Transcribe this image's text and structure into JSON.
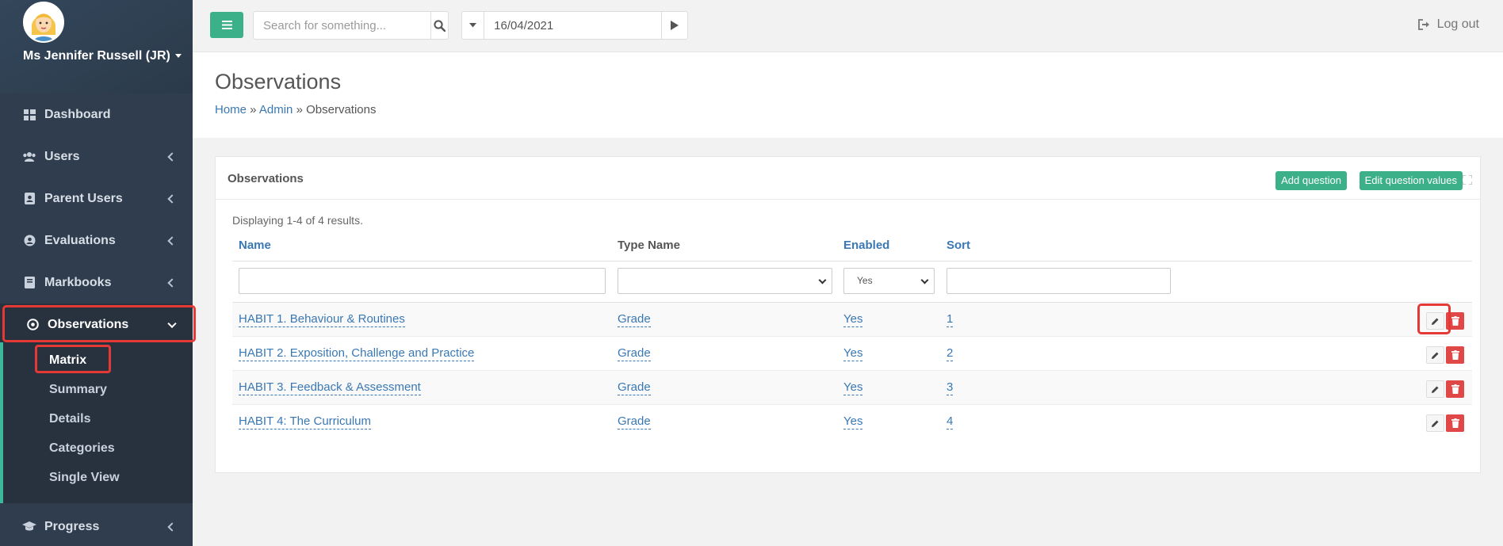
{
  "user": {
    "name": "Ms Jennifer Russell (JR)"
  },
  "sidebar": {
    "items": [
      {
        "label": "Dashboard",
        "icon": "dashboard-icon"
      },
      {
        "label": "Users",
        "icon": "users-icon"
      },
      {
        "label": "Parent Users",
        "icon": "parent-users-icon"
      },
      {
        "label": "Evaluations",
        "icon": "evaluations-icon"
      },
      {
        "label": "Markbooks",
        "icon": "markbooks-icon"
      },
      {
        "label": "Observations",
        "icon": "observations-icon",
        "active": true
      }
    ],
    "submenu": [
      {
        "label": "Matrix",
        "current": true
      },
      {
        "label": "Summary"
      },
      {
        "label": "Details"
      },
      {
        "label": "Categories"
      },
      {
        "label": "Single View"
      }
    ],
    "bottom_item": {
      "label": "Progress",
      "icon": "graduation-cap-icon"
    }
  },
  "topbar": {
    "search_placeholder": "Search for something...",
    "date_value": "16/04/2021",
    "logout_label": "Log out"
  },
  "page": {
    "title": "Observations",
    "breadcrumb": {
      "home": "Home",
      "sep1": " » ",
      "admin": "Admin",
      "sep2": " » ",
      "current": "Observations"
    }
  },
  "panel": {
    "title": "Observations",
    "add_question_label": "Add question",
    "edit_values_label": "Edit question values",
    "summary": "Displaying 1-4 of 4 results.",
    "columns": {
      "name": "Name",
      "type_name": "Type Name",
      "enabled": "Enabled",
      "sort": "Sort"
    },
    "filters": {
      "enabled_selected": "Yes"
    },
    "rows": [
      {
        "name": "HABIT 1. Behaviour & Routines",
        "type_name": "Grade",
        "enabled": "Yes",
        "sort": "1"
      },
      {
        "name": "HABIT 2. Exposition, Challenge and Practice",
        "type_name": "Grade",
        "enabled": "Yes",
        "sort": "2"
      },
      {
        "name": "HABIT 3. Feedback & Assessment",
        "type_name": "Grade",
        "enabled": "Yes",
        "sort": "3"
      },
      {
        "name": "HABIT 4: The Curriculum",
        "type_name": "Grade",
        "enabled": "Yes",
        "sort": "4"
      }
    ]
  },
  "colors": {
    "sidebar_bg": "#2f3d4e",
    "accent_green": "#3bb089",
    "link_blue": "#3a78b4",
    "delete_red": "#e04848",
    "highlight_red": "#e53935"
  }
}
